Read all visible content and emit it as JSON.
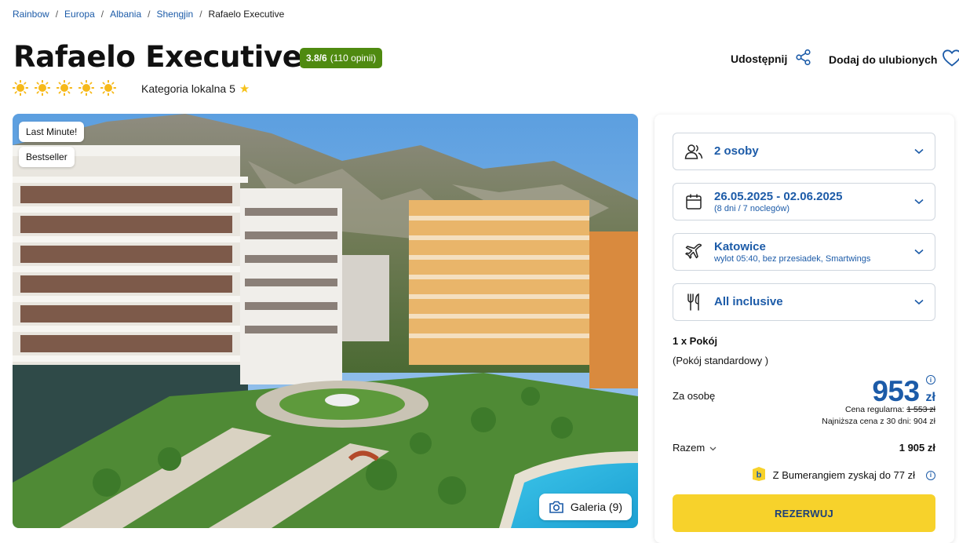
{
  "breadcrumb": [
    "Rainbow",
    "Europa",
    "Albania",
    "Shengjin",
    "Rafaelo Executive"
  ],
  "hotel": {
    "name": "Rafaelo Executive",
    "rating_score": "3.8/6",
    "rating_reviews": "(110 opinii)",
    "sun_count": 5,
    "local_category": "Kategoria lokalna 5"
  },
  "actions": {
    "share_label": "Udostępnij",
    "favorite_label": "Dodaj do ulubionych"
  },
  "image": {
    "tag_last_minute": "Last Minute!",
    "tag_bestseller": "Bestseller",
    "gallery_label": "Galeria (9)"
  },
  "booking": {
    "persons": "2 osoby",
    "dates": "26.05.2025 - 02.06.2025",
    "dates_sub": "(8 dni / 7 noclegów)",
    "departure": "Katowice",
    "departure_sub": "wylot 05:40, bez przesiadek, Smartwings",
    "board": "All inclusive",
    "room_title": "1 x Pokój",
    "room_type": "(Pokój standardowy )",
    "per_person_label": "Za osobę",
    "price": "953",
    "currency": "zł",
    "regular_label": "Cena regularna:",
    "regular_price": "1 553 zł",
    "lowest_label": "Najniższa cena z 30 dni: 904 zł",
    "total_label": "Razem",
    "total_value": "1 905 zł",
    "bumerang": "Z Bumerangiem zyskaj do 77 zł",
    "reserve_label": "REZERWUJ"
  },
  "colors": {
    "link": "#1c5ba8",
    "badge": "#4f8a10",
    "reserve": "#f7d22b",
    "sun": "#f6b91a"
  }
}
